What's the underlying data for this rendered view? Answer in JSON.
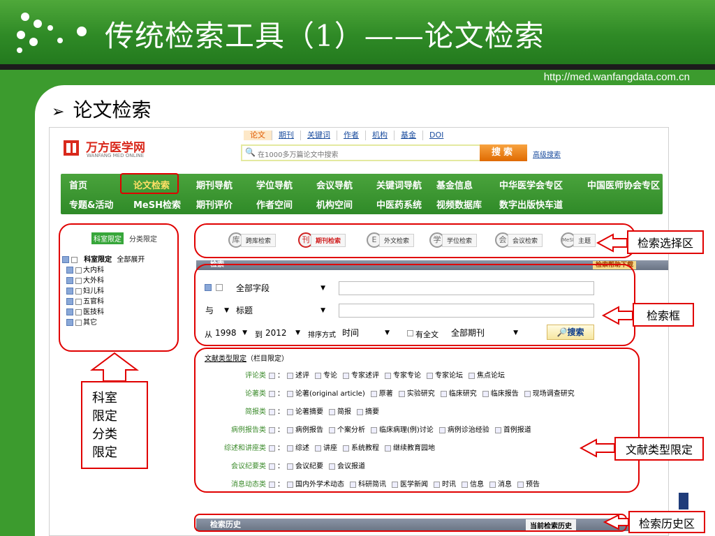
{
  "slide": {
    "title": "传统检索工具（1）——论文检索",
    "url": "http://med.wanfangdata.com.cn",
    "subhead": "论文检索",
    "subhead_bullet": "➢"
  },
  "site": {
    "logo_name": "万方医学网",
    "logo_sub": "WANFANG MED ONLINE",
    "search_tabs": [
      "论文",
      "期刊",
      "关键词",
      "作者",
      "机构",
      "基金",
      "DOI"
    ],
    "search_placeholder": "在1000多万篇论文中搜索",
    "search_button": "搜索",
    "advanced": "高级搜索"
  },
  "nav": {
    "row1": [
      "首页",
      "论文检索",
      "期刊导航",
      "学位导航",
      "会议导航",
      "关键词导航",
      "基金信息",
      "中华医学会专区",
      "中国医师协会专区"
    ],
    "row2": [
      "专题&活动",
      "MeSH检索",
      "期刊评价",
      "作者空间",
      "机构空间",
      "中医药系统",
      "视频数据库",
      "数字出版快车道"
    ]
  },
  "sidebar": {
    "tab_active": "科室限定",
    "tab_other": "分类限定",
    "tree_title": "科室限定",
    "expand_all": "全部展开",
    "items": [
      "大内科",
      "大外科",
      "妇儿科",
      "五官科",
      "医技科",
      "其它"
    ]
  },
  "modes": [
    "跨库检索",
    "期刊检索",
    "外文检索",
    "学位检索",
    "会议检索",
    "主题"
  ],
  "mode_icons": [
    "库",
    "刊",
    "E",
    "学",
    "会",
    "MeSH"
  ],
  "search_panel": {
    "bar_label": "检索",
    "help": "检索帮助下载",
    "field1": "全部字段",
    "logic": "与",
    "field2": "标题",
    "from_label": "从",
    "from_year": "1998",
    "to_label": "到",
    "to_year": "2012",
    "sort_label": "排序方式",
    "sort_value": "时间",
    "fulltext": "有全文",
    "journal_scope": "全部期刊",
    "search_button": "搜索"
  },
  "doc_types": {
    "header": "文献类型限定",
    "header_note": "（栏目限定）",
    "rows": [
      {
        "cat": "评论类",
        "opts": [
          "述评",
          "专论",
          "专家述评",
          "专家专论",
          "专家论坛",
          "焦点论坛"
        ]
      },
      {
        "cat": "论著类",
        "opts": [
          "论著(original article)",
          "原著",
          "实验研究",
          "临床研究",
          "临床报告",
          "现场调查研究"
        ]
      },
      {
        "cat": "简报类",
        "opts": [
          "论著摘要",
          "简报",
          "摘要"
        ]
      },
      {
        "cat": "病例报告类",
        "opts": [
          "病例报告",
          "个案分析",
          "临床病理(例)讨论",
          "病例诊治经验",
          "首例报道"
        ]
      },
      {
        "cat": "综述和讲座类",
        "opts": [
          "综述",
          "讲座",
          "系统教程",
          "继续教育园地"
        ]
      },
      {
        "cat": "会议纪要类",
        "opts": [
          "会议纪要",
          "会议报道"
        ]
      },
      {
        "cat": "消息动态类",
        "opts": [
          "国内外学术动态",
          "科研简讯",
          "医学新闻",
          "时讯",
          "信息",
          "消息",
          "预告"
        ]
      }
    ]
  },
  "history": {
    "bar_label": "检索历史",
    "current": "当前检索历史"
  },
  "annotations": {
    "mode_area": "检索选择区",
    "search_box": "检索框",
    "doc_type": "文献类型限定",
    "history": "检索历史区",
    "sidebar_lines": [
      "科室",
      "限定",
      "分类",
      "限定"
    ]
  },
  "colors": {
    "slide_green": "#3c9b2e",
    "annotation_red": "#e00000",
    "nav_green": "#3a9630",
    "brand_red": "#d9291c",
    "search_orange": "#f08a1c"
  }
}
